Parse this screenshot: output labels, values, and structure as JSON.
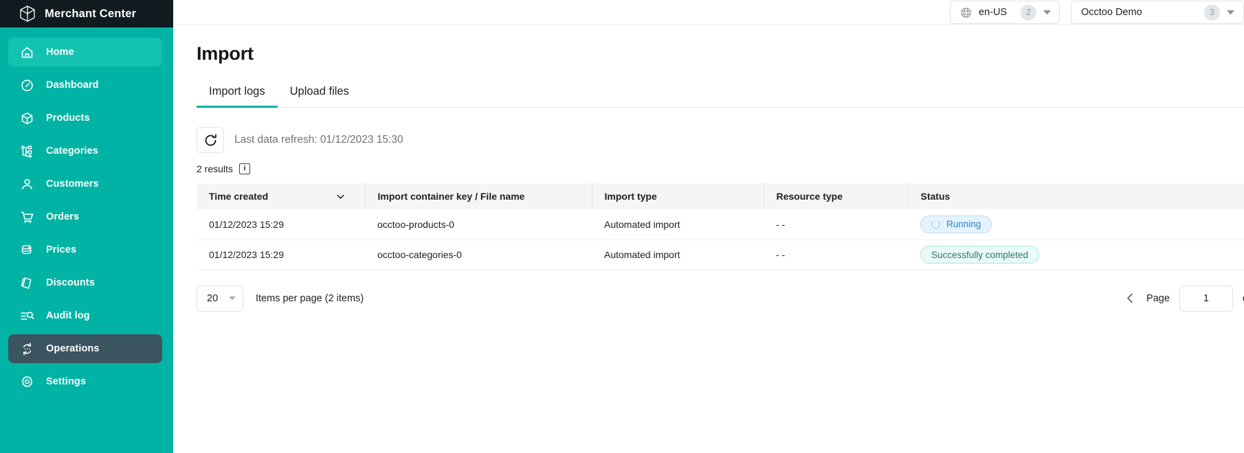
{
  "sidebar": {
    "brand": {
      "title": "Merchant Center",
      "logo_icon": "cube-outline-icon"
    },
    "items": [
      {
        "label": "Home",
        "icon": "home-icon",
        "state": "active-light"
      },
      {
        "label": "Dashboard",
        "icon": "gauge-icon",
        "state": ""
      },
      {
        "label": "Products",
        "icon": "cube-icon",
        "state": ""
      },
      {
        "label": "Categories",
        "icon": "tree-nodes-icon",
        "state": ""
      },
      {
        "label": "Customers",
        "icon": "user-icon",
        "state": ""
      },
      {
        "label": "Orders",
        "icon": "cart-icon",
        "state": ""
      },
      {
        "label": "Prices",
        "icon": "coins-icon",
        "state": ""
      },
      {
        "label": "Discounts",
        "icon": "tag-icon",
        "state": ""
      },
      {
        "label": "Audit log",
        "icon": "list-search-icon",
        "state": ""
      },
      {
        "label": "Operations",
        "icon": "sync-arrows-icon",
        "state": "active-dark"
      },
      {
        "label": "Settings",
        "icon": "gear-icon",
        "state": ""
      }
    ],
    "accent_color": "#00b3a4",
    "active_light_color": "#14c2b2",
    "active_dark_color": "#3a5560",
    "brand_bar_color": "#101b1f"
  },
  "topbar": {
    "locale": {
      "icon": "globe-icon",
      "label": "en-US",
      "count": "2",
      "caret_icon": "chevron-down-icon"
    },
    "project": {
      "label": "Occtoo Demo",
      "count": "3",
      "caret_icon": "chevron-down-icon"
    }
  },
  "page": {
    "title": "Import",
    "tabs": [
      {
        "label": "Import logs",
        "active": true
      },
      {
        "label": "Upload files",
        "active": false
      }
    ],
    "refresh": {
      "icon": "refresh-icon",
      "text": "Last data refresh: 01/12/2023 15:30"
    },
    "results": {
      "text": "2 results",
      "info_icon_label": "i"
    }
  },
  "table": {
    "columns": [
      {
        "label": "Time created",
        "sortable": true,
        "sort_icon": "chevron-down-icon"
      },
      {
        "label": "Import container key / File name",
        "sortable": false
      },
      {
        "label": "Import type",
        "sortable": false
      },
      {
        "label": "Resource type",
        "sortable": false
      },
      {
        "label": "Status",
        "sortable": false
      }
    ],
    "rows": [
      {
        "time_created": "01/12/2023 15:29",
        "container_key": "occtoo-products-0",
        "import_type": "Automated import",
        "resource_type": "- -",
        "status": {
          "label": "Running",
          "variant": "running",
          "icon": "spinner-icon"
        }
      },
      {
        "time_created": "01/12/2023 15:29",
        "container_key": "occtoo-categories-0",
        "import_type": "Automated import",
        "resource_type": "- -",
        "status": {
          "label": "Successfully completed",
          "variant": "success",
          "icon": ""
        }
      }
    ]
  },
  "pagination": {
    "per_page_value": "20",
    "per_page_label": "Items per page (2 items)",
    "prev_icon": "chevron-left-icon",
    "page_word": "Page",
    "page_value": "1",
    "of_word": "o"
  },
  "colors": {
    "teal": "#00b3a4",
    "running_badge_bg": "#e5f3fc",
    "running_badge_text": "#2a82c8",
    "success_badge_bg": "#e9fbf6",
    "success_badge_text": "#30766a"
  }
}
